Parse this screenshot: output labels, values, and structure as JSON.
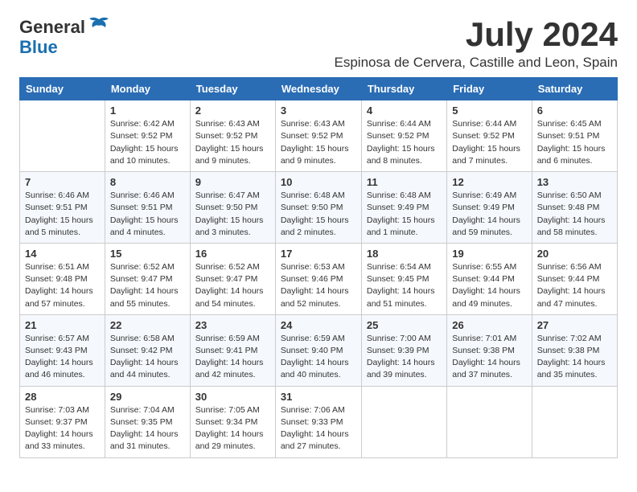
{
  "logo": {
    "general": "General",
    "blue": "Blue"
  },
  "title": {
    "month": "July 2024",
    "location": "Espinosa de Cervera, Castille and Leon, Spain"
  },
  "weekdays": [
    "Sunday",
    "Monday",
    "Tuesday",
    "Wednesday",
    "Thursday",
    "Friday",
    "Saturday"
  ],
  "weeks": [
    [
      {
        "day": "",
        "sunrise": "",
        "sunset": "",
        "daylight": ""
      },
      {
        "day": "1",
        "sunrise": "Sunrise: 6:42 AM",
        "sunset": "Sunset: 9:52 PM",
        "daylight": "Daylight: 15 hours and 10 minutes."
      },
      {
        "day": "2",
        "sunrise": "Sunrise: 6:43 AM",
        "sunset": "Sunset: 9:52 PM",
        "daylight": "Daylight: 15 hours and 9 minutes."
      },
      {
        "day": "3",
        "sunrise": "Sunrise: 6:43 AM",
        "sunset": "Sunset: 9:52 PM",
        "daylight": "Daylight: 15 hours and 9 minutes."
      },
      {
        "day": "4",
        "sunrise": "Sunrise: 6:44 AM",
        "sunset": "Sunset: 9:52 PM",
        "daylight": "Daylight: 15 hours and 8 minutes."
      },
      {
        "day": "5",
        "sunrise": "Sunrise: 6:44 AM",
        "sunset": "Sunset: 9:52 PM",
        "daylight": "Daylight: 15 hours and 7 minutes."
      },
      {
        "day": "6",
        "sunrise": "Sunrise: 6:45 AM",
        "sunset": "Sunset: 9:51 PM",
        "daylight": "Daylight: 15 hours and 6 minutes."
      }
    ],
    [
      {
        "day": "7",
        "sunrise": "Sunrise: 6:46 AM",
        "sunset": "Sunset: 9:51 PM",
        "daylight": "Daylight: 15 hours and 5 minutes."
      },
      {
        "day": "8",
        "sunrise": "Sunrise: 6:46 AM",
        "sunset": "Sunset: 9:51 PM",
        "daylight": "Daylight: 15 hours and 4 minutes."
      },
      {
        "day": "9",
        "sunrise": "Sunrise: 6:47 AM",
        "sunset": "Sunset: 9:50 PM",
        "daylight": "Daylight: 15 hours and 3 minutes."
      },
      {
        "day": "10",
        "sunrise": "Sunrise: 6:48 AM",
        "sunset": "Sunset: 9:50 PM",
        "daylight": "Daylight: 15 hours and 2 minutes."
      },
      {
        "day": "11",
        "sunrise": "Sunrise: 6:48 AM",
        "sunset": "Sunset: 9:49 PM",
        "daylight": "Daylight: 15 hours and 1 minute."
      },
      {
        "day": "12",
        "sunrise": "Sunrise: 6:49 AM",
        "sunset": "Sunset: 9:49 PM",
        "daylight": "Daylight: 14 hours and 59 minutes."
      },
      {
        "day": "13",
        "sunrise": "Sunrise: 6:50 AM",
        "sunset": "Sunset: 9:48 PM",
        "daylight": "Daylight: 14 hours and 58 minutes."
      }
    ],
    [
      {
        "day": "14",
        "sunrise": "Sunrise: 6:51 AM",
        "sunset": "Sunset: 9:48 PM",
        "daylight": "Daylight: 14 hours and 57 minutes."
      },
      {
        "day": "15",
        "sunrise": "Sunrise: 6:52 AM",
        "sunset": "Sunset: 9:47 PM",
        "daylight": "Daylight: 14 hours and 55 minutes."
      },
      {
        "day": "16",
        "sunrise": "Sunrise: 6:52 AM",
        "sunset": "Sunset: 9:47 PM",
        "daylight": "Daylight: 14 hours and 54 minutes."
      },
      {
        "day": "17",
        "sunrise": "Sunrise: 6:53 AM",
        "sunset": "Sunset: 9:46 PM",
        "daylight": "Daylight: 14 hours and 52 minutes."
      },
      {
        "day": "18",
        "sunrise": "Sunrise: 6:54 AM",
        "sunset": "Sunset: 9:45 PM",
        "daylight": "Daylight: 14 hours and 51 minutes."
      },
      {
        "day": "19",
        "sunrise": "Sunrise: 6:55 AM",
        "sunset": "Sunset: 9:44 PM",
        "daylight": "Daylight: 14 hours and 49 minutes."
      },
      {
        "day": "20",
        "sunrise": "Sunrise: 6:56 AM",
        "sunset": "Sunset: 9:44 PM",
        "daylight": "Daylight: 14 hours and 47 minutes."
      }
    ],
    [
      {
        "day": "21",
        "sunrise": "Sunrise: 6:57 AM",
        "sunset": "Sunset: 9:43 PM",
        "daylight": "Daylight: 14 hours and 46 minutes."
      },
      {
        "day": "22",
        "sunrise": "Sunrise: 6:58 AM",
        "sunset": "Sunset: 9:42 PM",
        "daylight": "Daylight: 14 hours and 44 minutes."
      },
      {
        "day": "23",
        "sunrise": "Sunrise: 6:59 AM",
        "sunset": "Sunset: 9:41 PM",
        "daylight": "Daylight: 14 hours and 42 minutes."
      },
      {
        "day": "24",
        "sunrise": "Sunrise: 6:59 AM",
        "sunset": "Sunset: 9:40 PM",
        "daylight": "Daylight: 14 hours and 40 minutes."
      },
      {
        "day": "25",
        "sunrise": "Sunrise: 7:00 AM",
        "sunset": "Sunset: 9:39 PM",
        "daylight": "Daylight: 14 hours and 39 minutes."
      },
      {
        "day": "26",
        "sunrise": "Sunrise: 7:01 AM",
        "sunset": "Sunset: 9:38 PM",
        "daylight": "Daylight: 14 hours and 37 minutes."
      },
      {
        "day": "27",
        "sunrise": "Sunrise: 7:02 AM",
        "sunset": "Sunset: 9:38 PM",
        "daylight": "Daylight: 14 hours and 35 minutes."
      }
    ],
    [
      {
        "day": "28",
        "sunrise": "Sunrise: 7:03 AM",
        "sunset": "Sunset: 9:37 PM",
        "daylight": "Daylight: 14 hours and 33 minutes."
      },
      {
        "day": "29",
        "sunrise": "Sunrise: 7:04 AM",
        "sunset": "Sunset: 9:35 PM",
        "daylight": "Daylight: 14 hours and 31 minutes."
      },
      {
        "day": "30",
        "sunrise": "Sunrise: 7:05 AM",
        "sunset": "Sunset: 9:34 PM",
        "daylight": "Daylight: 14 hours and 29 minutes."
      },
      {
        "day": "31",
        "sunrise": "Sunrise: 7:06 AM",
        "sunset": "Sunset: 9:33 PM",
        "daylight": "Daylight: 14 hours and 27 minutes."
      },
      {
        "day": "",
        "sunrise": "",
        "sunset": "",
        "daylight": ""
      },
      {
        "day": "",
        "sunrise": "",
        "sunset": "",
        "daylight": ""
      },
      {
        "day": "",
        "sunrise": "",
        "sunset": "",
        "daylight": ""
      }
    ]
  ]
}
